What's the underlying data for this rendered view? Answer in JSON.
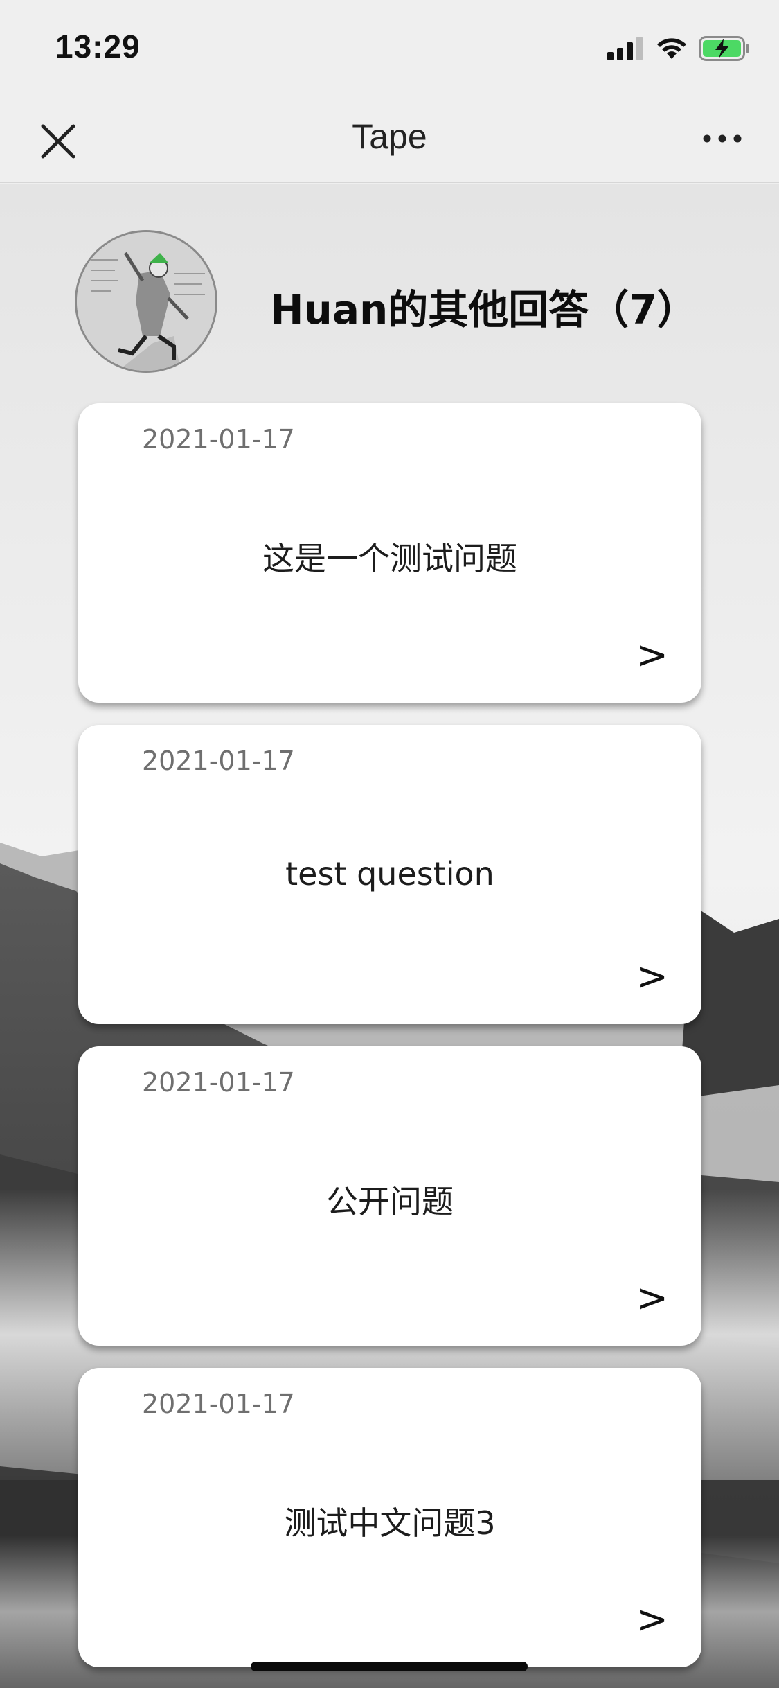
{
  "status": {
    "time": "13:29"
  },
  "nav": {
    "title": "Tape"
  },
  "header": {
    "title": "Huan的其他回答（7）"
  },
  "cards": [
    {
      "date": "2021-01-17",
      "question": "这是一个测试问题",
      "arrow": ">"
    },
    {
      "date": "2021-01-17",
      "question": "test question",
      "arrow": ">"
    },
    {
      "date": "2021-01-17",
      "question": "公开问题",
      "arrow": ">"
    },
    {
      "date": "2021-01-17",
      "question": "测试中文问题3",
      "arrow": ">"
    }
  ],
  "colors": {
    "battery": "#4cd964",
    "avatar_hat": "#3fb24a",
    "background_top": "#efefef"
  },
  "icons": [
    "signal-icon",
    "wifi-icon",
    "battery-charging-icon",
    "close-icon",
    "more-icon"
  ]
}
